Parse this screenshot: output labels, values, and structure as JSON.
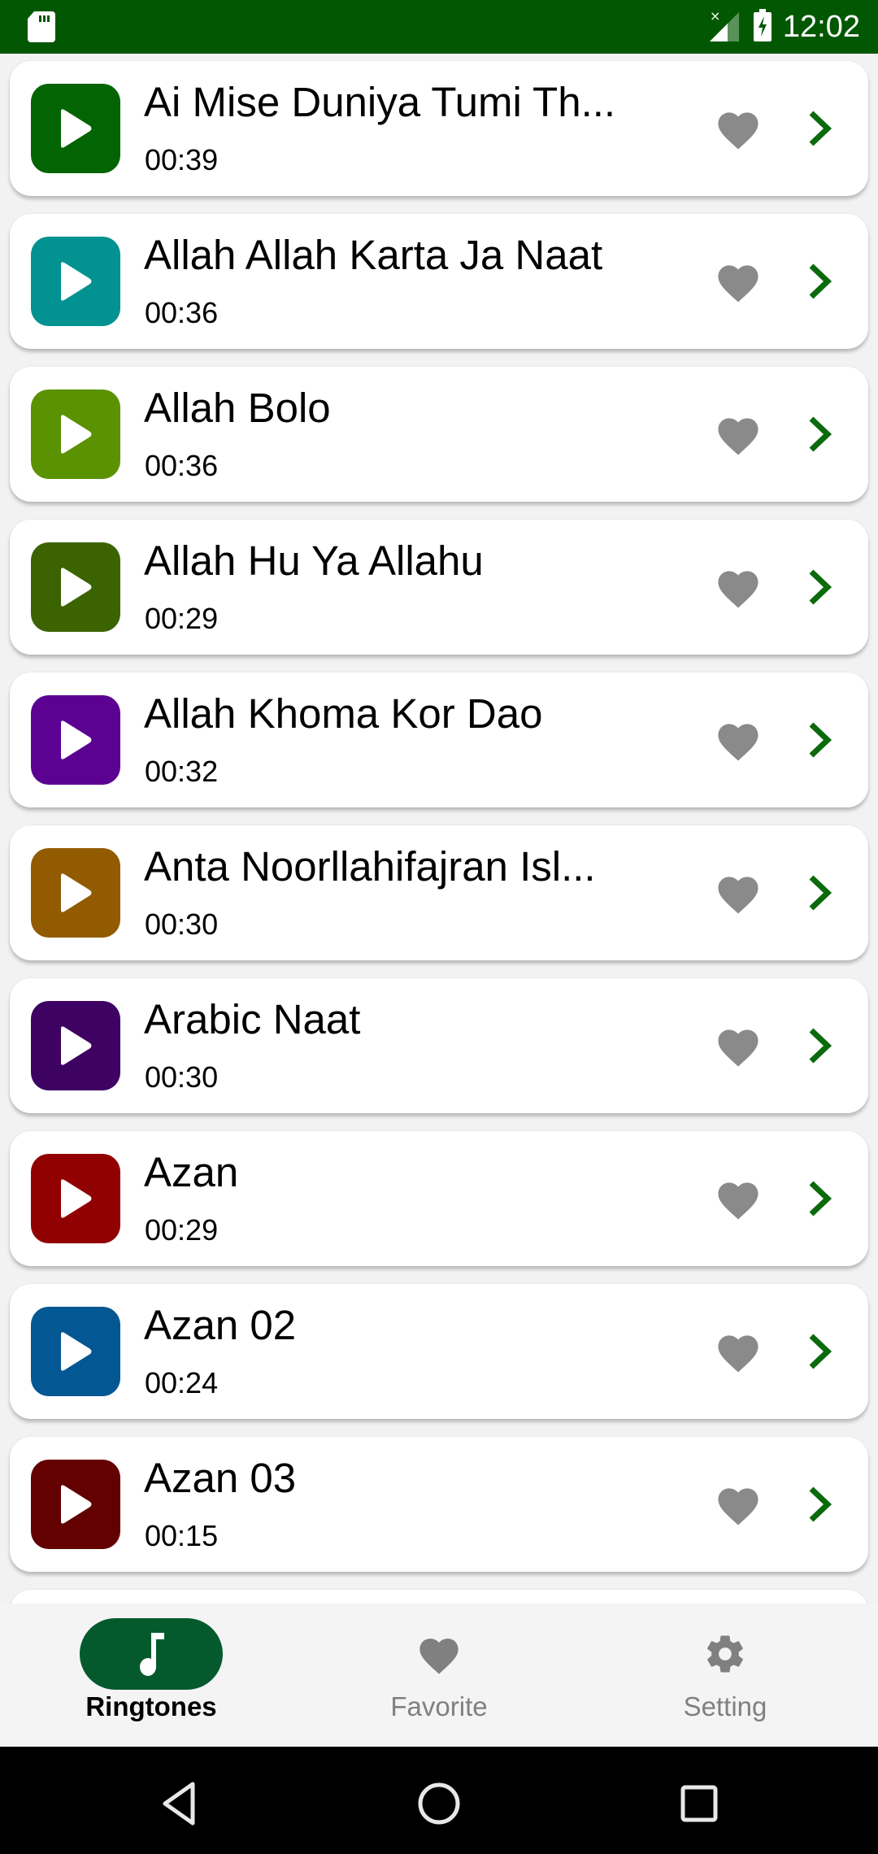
{
  "status_bar": {
    "time": "12:02",
    "icons": [
      "sd-card-icon",
      "signal-no-service-icon",
      "battery-charging-icon"
    ]
  },
  "colors": {
    "status_bar": "#025802",
    "chevron": "#0b6a0b",
    "heart": "#8a8a8a",
    "nav_active_pill": "#045a2d"
  },
  "ringtones": [
    {
      "title": "Ai Mise Duniya Tumi Th...",
      "duration": "00:39",
      "color": "#026402"
    },
    {
      "title": "Allah Allah Karta Ja Naat",
      "duration": "00:36",
      "color": "#019291"
    },
    {
      "title": "Allah Bolo",
      "duration": "00:36",
      "color": "#5b9202"
    },
    {
      "title": "Allah Hu Ya Allahu",
      "duration": "00:29",
      "color": "#3b6401"
    },
    {
      "title": "Allah Khoma Kor Dao",
      "duration": "00:32",
      "color": "#5c0293"
    },
    {
      "title": "Anta Noorllahifajran Isl...",
      "duration": "00:30",
      "color": "#925b02"
    },
    {
      "title": "Arabic Naat",
      "duration": "00:30",
      "color": "#3e0263"
    },
    {
      "title": "Azan",
      "duration": "00:29",
      "color": "#920101"
    },
    {
      "title": "Azan 02",
      "duration": "00:24",
      "color": "#035893"
    },
    {
      "title": "Azan 03",
      "duration": "00:15",
      "color": "#630101"
    }
  ],
  "bottom_nav": {
    "items": [
      {
        "label": "Ringtones",
        "icon": "music-note-icon",
        "active": true
      },
      {
        "label": "Favorite",
        "icon": "heart-icon",
        "active": false
      },
      {
        "label": "Setting",
        "icon": "gear-icon",
        "active": false
      }
    ]
  },
  "system_nav": {
    "buttons": [
      "back-icon",
      "home-icon",
      "recents-icon"
    ]
  }
}
